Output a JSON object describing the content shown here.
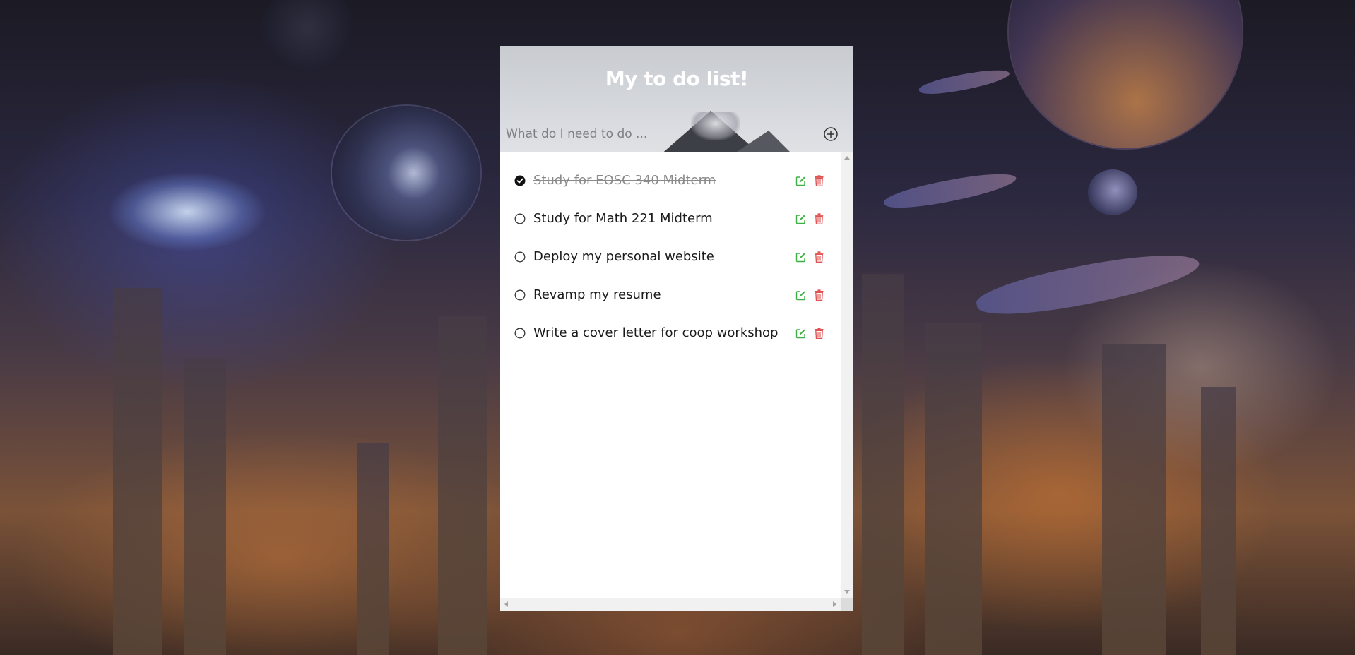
{
  "header": {
    "title": "My to do list!",
    "input_placeholder": "What do I need to do ...",
    "input_value": "",
    "add_icon": "circle-plus-icon"
  },
  "todos": [
    {
      "text": "Study for EOSC 340 Midterm",
      "completed": true
    },
    {
      "text": "Study for Math 221 Midterm",
      "completed": false
    },
    {
      "text": "Deploy my personal website",
      "completed": false
    },
    {
      "text": "Revamp my resume",
      "completed": false
    },
    {
      "text": "Write a cover letter for coop workshop",
      "completed": false
    }
  ],
  "icons": {
    "complete": "circle-check-icon",
    "incomplete": "circle-icon",
    "edit": "edit-icon",
    "delete": "trash-icon"
  },
  "colors": {
    "edit": "#3cb043",
    "delete": "#e05252",
    "title": "#ffffff",
    "completed_text": "#8a8a8a"
  }
}
